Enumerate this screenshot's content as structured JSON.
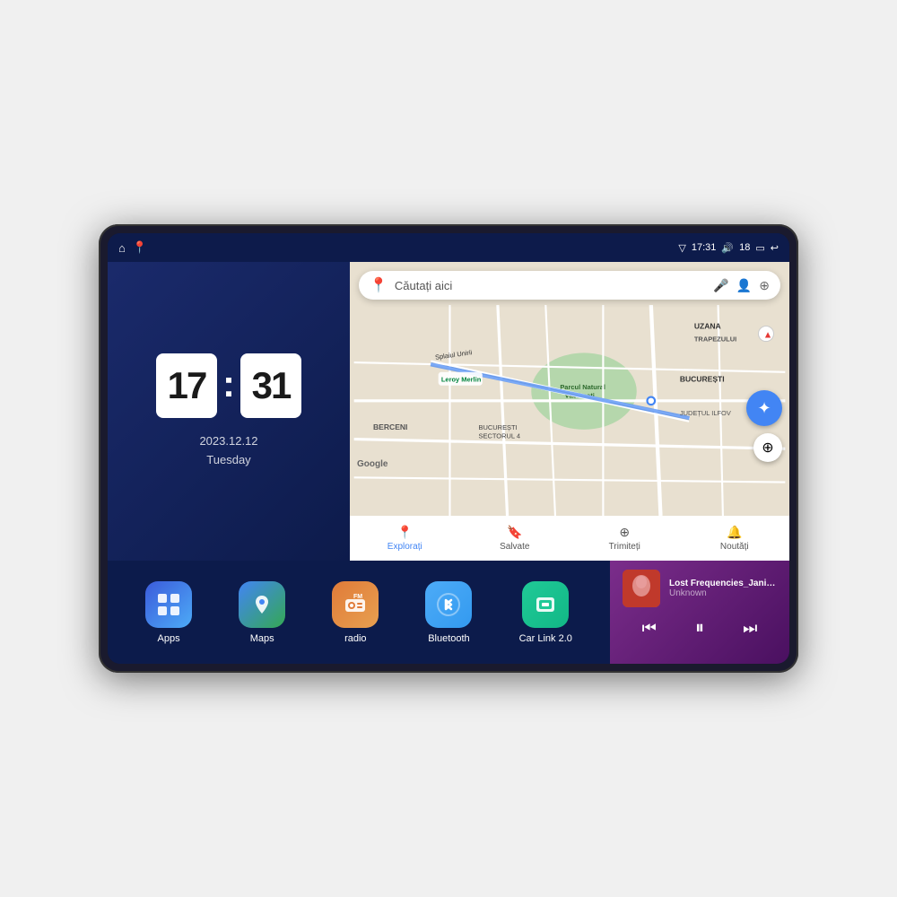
{
  "device": {
    "title": "Android Car Head Unit"
  },
  "statusBar": {
    "leftIcons": [
      "home-icon",
      "maps-status-icon"
    ],
    "time": "17:31",
    "volume": "18",
    "battery": "▭",
    "back": "↩"
  },
  "clock": {
    "hour": "17",
    "minute": "31",
    "date": "2023.12.12",
    "day": "Tuesday"
  },
  "map": {
    "searchPlaceholder": "Căutați aici",
    "navItems": [
      {
        "label": "Explorați",
        "icon": "📍",
        "active": true
      },
      {
        "label": "Salvate",
        "icon": "🔖",
        "active": false
      },
      {
        "label": "Trimiteți",
        "icon": "⊕",
        "active": false
      },
      {
        "label": "Noutăți",
        "icon": "🔔",
        "active": false
      }
    ],
    "labels": {
      "parcul": "Parcul Natural Văcărești",
      "leroy": "Leroy Merlin",
      "berceni": "BERCENI",
      "bucuresti": "BUCUREȘTI",
      "ilfov": "JUDEȚUL ILFOV",
      "sectorulText": "BUCUREȘTI\nSECTORUL 4",
      "uzana": "UZANA",
      "trapezului": "TRAPEZULUI",
      "splaiul": "Splaiul Unirii"
    },
    "googleLogo": "Google"
  },
  "apps": [
    {
      "id": "apps",
      "label": "Apps",
      "iconClass": "apps-icon",
      "icon": "⊞"
    },
    {
      "id": "maps",
      "label": "Maps",
      "iconClass": "maps-icon",
      "icon": "📍"
    },
    {
      "id": "radio",
      "label": "radio",
      "iconClass": "radio-icon",
      "icon": "📻"
    },
    {
      "id": "bluetooth",
      "label": "Bluetooth",
      "iconClass": "bluetooth-icon",
      "icon": "⬡"
    },
    {
      "id": "carlink",
      "label": "Car Link 2.0",
      "iconClass": "carlink-icon",
      "icon": "📱"
    }
  ],
  "music": {
    "title": "Lost Frequencies_Janieck Devy-...",
    "artist": "Unknown",
    "controls": {
      "prev": "⏮",
      "play": "⏸",
      "next": "⏭"
    }
  }
}
